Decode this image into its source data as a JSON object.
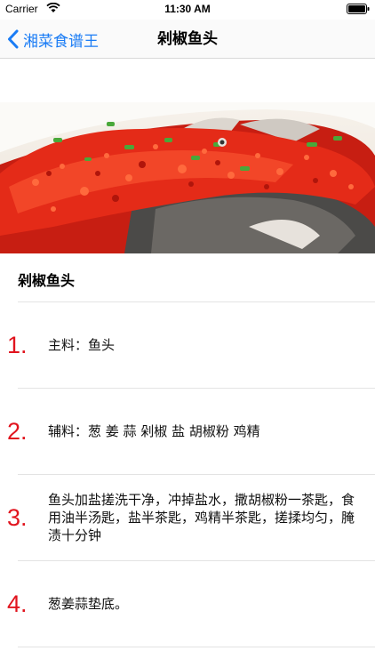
{
  "status_bar": {
    "carrier": "Carrier",
    "time": "11:30 AM",
    "icons": [
      "wifi-icon",
      "battery-icon"
    ]
  },
  "nav": {
    "back_label": "湘菜食谱王",
    "title": "剁椒鱼头",
    "accent_color": "#1a7cf5"
  },
  "recipe": {
    "title": "剁椒鱼头",
    "number_color": "#e1141e",
    "steps": [
      {
        "number": "1.",
        "text": "主料：鱼头"
      },
      {
        "number": "2.",
        "text": "辅料：葱 姜 蒜 剁椒 盐 胡椒粉 鸡精"
      },
      {
        "number": "3.",
        "text": "鱼头加盐搓洗干净，冲掉盐水，撒胡椒粉一茶匙，食用油半汤匙，盐半茶匙，鸡精半茶匙，搓揉均匀，腌渍十分钟"
      },
      {
        "number": "4.",
        "text": "葱姜蒜垫底。"
      }
    ]
  }
}
